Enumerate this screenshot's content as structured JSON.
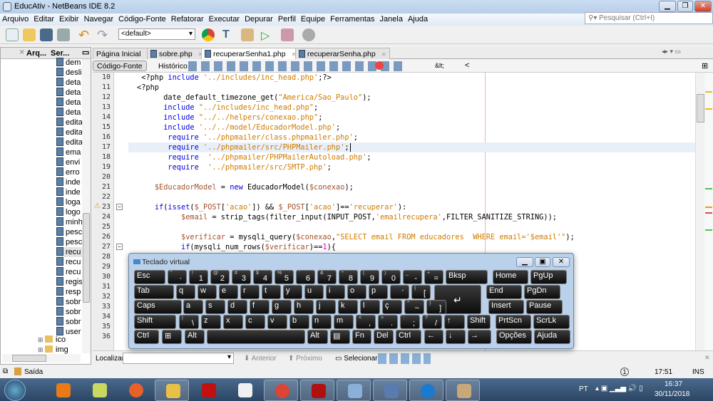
{
  "window": {
    "title": "EducAtiv - NetBeans IDE 8.2",
    "minimize": "▁",
    "restore": "❐",
    "close": "✕"
  },
  "menu": [
    "Arquivo",
    "Editar",
    "Exibir",
    "Navegar",
    "Código-Fonte",
    "Refatorar",
    "Executar",
    "Depurar",
    "Perfil",
    "Equipe",
    "Ferramentas",
    "Janela",
    "Ajuda"
  ],
  "search": {
    "placeholder": "Pesquisar (Ctrl+I)",
    "icon": "search-icon"
  },
  "toolbar": {
    "config": "<default>",
    "icons": [
      "new-file-icon",
      "new-project-icon",
      "open-project-icon",
      "close-project-icon",
      "undo-icon",
      "redo-icon",
      "chrome-icon",
      "build-icon",
      "clean-build-icon",
      "run-icon",
      "debug-icon",
      "profile-icon"
    ]
  },
  "left_panel": {
    "tabs": [
      "Arq...",
      "Ser..."
    ],
    "files": [
      "dem",
      "desli",
      "deta",
      "deta",
      "deta",
      "deta",
      "edita",
      "edita",
      "edita",
      "ema",
      "envi",
      "erro",
      "inde",
      "inde",
      "loga",
      "logo",
      "minh",
      "pesc",
      "pesc",
      "recu",
      "recu",
      "recu",
      "regis",
      "resp",
      "sobr",
      "sobr",
      "sobr",
      "user"
    ],
    "selected_index": 19,
    "folders": [
      "ico",
      "img"
    ]
  },
  "editor_tabs": [
    {
      "label": "Página Inicial",
      "active": false
    },
    {
      "label": "sobre.php",
      "active": false
    },
    {
      "label": "recuperarSenha1.php",
      "active": true
    },
    {
      "label": "recuperarSenha.php",
      "active": false
    }
  ],
  "editor_toolbar": {
    "source": "Código-Fonte",
    "history": "Histórico",
    "entity": "&lt;",
    "lt": "<"
  },
  "code": {
    "current_line": 17,
    "lines": [
      {
        "n": 10,
        "t": [
          [
            " <?php ",
            "p"
          ],
          [
            "include ",
            "k"
          ],
          [
            "'../includes/inc_head.php'",
            "s"
          ],
          [
            ";?>",
            "p"
          ]
        ]
      },
      {
        "n": 11,
        "t": [
          [
            "<?php",
            "p"
          ]
        ]
      },
      {
        "n": 12,
        "t": [
          [
            "      date_default_timezone_get(",
            "p"
          ],
          [
            "\"America/Sao_Paulo\"",
            "s"
          ],
          [
            ");",
            "p"
          ]
        ]
      },
      {
        "n": 13,
        "t": [
          [
            "      ",
            "p"
          ],
          [
            "include ",
            "k"
          ],
          [
            "\"../includes/inc_head.php\"",
            "s"
          ],
          [
            ";",
            "p"
          ]
        ]
      },
      {
        "n": 14,
        "t": [
          [
            "      ",
            "p"
          ],
          [
            "include ",
            "k"
          ],
          [
            "\"../../helpers/conexao.php\"",
            "s"
          ],
          [
            ";",
            "p"
          ]
        ]
      },
      {
        "n": 15,
        "t": [
          [
            "      ",
            "p"
          ],
          [
            "include ",
            "k"
          ],
          [
            "'../../model/EducadorModel.php'",
            "s"
          ],
          [
            ";",
            "p"
          ]
        ]
      },
      {
        "n": 16,
        "t": [
          [
            "       ",
            "p"
          ],
          [
            "require ",
            "k"
          ],
          [
            "'../phpmailer/class.phpmailer.php'",
            "s"
          ],
          [
            ";",
            "p"
          ]
        ]
      },
      {
        "n": 17,
        "t": [
          [
            "       ",
            "p"
          ],
          [
            "require ",
            "k"
          ],
          [
            "'../phpmailer/src/PHPMailer.php'",
            "s"
          ],
          [
            ";",
            "p"
          ]
        ]
      },
      {
        "n": 18,
        "t": [
          [
            "       ",
            "p"
          ],
          [
            "require  ",
            "k"
          ],
          [
            "'../phpmailer/PHPMailerAutoload.php'",
            "s"
          ],
          [
            ";",
            "p"
          ]
        ]
      },
      {
        "n": 19,
        "t": [
          [
            "       ",
            "p"
          ],
          [
            "require  ",
            "k"
          ],
          [
            "'../phpmailer/src/SMTP.php'",
            "s"
          ],
          [
            ";",
            "p"
          ]
        ]
      },
      {
        "n": 20,
        "t": []
      },
      {
        "n": 21,
        "t": [
          [
            "    ",
            "p"
          ],
          [
            "$EducadorModel",
            "v"
          ],
          [
            " = ",
            "p"
          ],
          [
            "new ",
            "k"
          ],
          [
            "EducadorModel(",
            "p"
          ],
          [
            "$conexao",
            "v"
          ],
          [
            ");",
            "p"
          ]
        ]
      },
      {
        "n": 22,
        "t": []
      },
      {
        "n": 23,
        "warning": true,
        "fold": true,
        "t": [
          [
            "    ",
            "p"
          ],
          [
            "if",
            "k"
          ],
          [
            "(",
            "p"
          ],
          [
            "isset",
            "k"
          ],
          [
            "(",
            "p"
          ],
          [
            "$_POST",
            "v"
          ],
          [
            "[",
            "p"
          ],
          [
            "'acao'",
            "s"
          ],
          [
            "]) && ",
            "p"
          ],
          [
            "$_POST",
            "v"
          ],
          [
            "[",
            "p"
          ],
          [
            "'acao'",
            "s"
          ],
          [
            "]==",
            "p"
          ],
          [
            "'recuperar'",
            "s"
          ],
          [
            "):",
            "p"
          ]
        ]
      },
      {
        "n": 24,
        "t": [
          [
            "          ",
            "p"
          ],
          [
            "$email",
            "v"
          ],
          [
            " = strip_tags(filter_input(INPUT_POST,",
            "p"
          ],
          [
            "'emailrecupera'",
            "s"
          ],
          [
            ",FILTER_SANITIZE_STRING));",
            "p"
          ]
        ]
      },
      {
        "n": 25,
        "t": []
      },
      {
        "n": 26,
        "t": [
          [
            "          ",
            "p"
          ],
          [
            "$verificar",
            "v"
          ],
          [
            " = mysqli_query(",
            "p"
          ],
          [
            "$conexao",
            "v"
          ],
          [
            ",",
            "p"
          ],
          [
            "\"SELECT email FROM educadores  WHERE email='$email'\"",
            "s"
          ],
          [
            ");",
            "p"
          ]
        ]
      },
      {
        "n": 27,
        "fold": true,
        "t": [
          [
            "          ",
            "p"
          ],
          [
            "if",
            "k"
          ],
          [
            "(mysqli_num_rows(",
            "p"
          ],
          [
            "$verificar",
            "v"
          ],
          [
            ")==",
            "p"
          ],
          [
            "1",
            "n"
          ],
          [
            "){",
            "p"
          ]
        ]
      },
      {
        "n": 28,
        "t": []
      },
      {
        "n": 29,
        "t": []
      },
      {
        "n": 30,
        "t": []
      },
      {
        "n": 31,
        "t": []
      },
      {
        "n": 32,
        "t": []
      },
      {
        "n": 33,
        "t": []
      },
      {
        "n": 34,
        "t": []
      },
      {
        "n": 35,
        "t": []
      },
      {
        "n": 36,
        "t": []
      }
    ]
  },
  "find_bar": {
    "label": "Localizar:",
    "previous": "Anterior",
    "next": "Próximo",
    "select": "Selecionar"
  },
  "status": {
    "output": "Saída",
    "position": "17:51",
    "mode": "INS",
    "notifications": "1"
  },
  "keyboard": {
    "title": "Teclado virtual",
    "rows": [
      [
        [
          "Esc"
        ],
        [
          "·",
          "\""
        ],
        [
          "1",
          "!"
        ],
        [
          "2",
          "@"
        ],
        [
          "3",
          "#"
        ],
        [
          "4",
          "$"
        ],
        [
          "5",
          "%"
        ],
        [
          "6",
          "¨"
        ],
        [
          "7",
          "&"
        ],
        [
          "8",
          "*"
        ],
        [
          "9",
          "("
        ],
        [
          "0",
          ")"
        ],
        [
          "-",
          "_"
        ],
        [
          "=",
          "+"
        ],
        [
          "Bksp"
        ],
        [
          "Home"
        ],
        [
          "PgUp"
        ]
      ],
      [
        [
          "Tab"
        ],
        [
          "q"
        ],
        [
          "w"
        ],
        [
          "e"
        ],
        [
          "r"
        ],
        [
          "t"
        ],
        [
          "y"
        ],
        [
          "u"
        ],
        [
          "i"
        ],
        [
          "o"
        ],
        [
          "p"
        ],
        [
          "´",
          "`"
        ],
        [
          "[",
          "{"
        ],
        [
          "↵"
        ],
        [
          "End"
        ],
        [
          "PgDn"
        ]
      ],
      [
        [
          "Caps"
        ],
        [
          "a"
        ],
        [
          "s"
        ],
        [
          "d"
        ],
        [
          "f"
        ],
        [
          "g"
        ],
        [
          "h"
        ],
        [
          "j"
        ],
        [
          "k"
        ],
        [
          "l"
        ],
        [
          "ç"
        ],
        [
          "~",
          "^"
        ],
        [
          "]",
          "}"
        ],
        [
          "Insert"
        ],
        [
          "Pause"
        ]
      ],
      [
        [
          "Shift"
        ],
        [
          "\\",
          "|"
        ],
        [
          "z"
        ],
        [
          "x"
        ],
        [
          "c"
        ],
        [
          "v"
        ],
        [
          "b"
        ],
        [
          "n"
        ],
        [
          "m"
        ],
        [
          ",",
          "<"
        ],
        [
          ".",
          ">"
        ],
        [
          ";",
          ":"
        ],
        [
          "/",
          "?"
        ],
        [
          "↑"
        ],
        [
          "Shift"
        ],
        [
          "PrtScn"
        ],
        [
          "ScrLk"
        ]
      ],
      [
        [
          "Ctrl"
        ],
        [
          "⊞"
        ],
        [
          "Alt"
        ],
        [
          ""
        ],
        [
          "Alt"
        ],
        [
          "▤"
        ],
        [
          "Fn"
        ],
        [
          "Del"
        ],
        [
          "Ctrl"
        ],
        [
          "←"
        ],
        [
          "↓"
        ],
        [
          "→"
        ],
        [
          "Opções"
        ],
        [
          "Ajuda"
        ]
      ]
    ]
  },
  "taskbar": {
    "apps": [
      "windows-media-player",
      "sticky-notes",
      "firefox",
      "file-explorer",
      "davinci",
      "mu-editor",
      "chrome",
      "filezilla",
      "virtualbox",
      "remote-desktop",
      "hotspot-shield",
      "paint"
    ],
    "language": "PT",
    "time": "16:37",
    "date": "30/11/2018"
  },
  "colors": {
    "keyword": "#0000e6",
    "string": "#ce7b00",
    "variable": "#a0522d",
    "number": "#e000e0",
    "margin": "#f4b0b0"
  }
}
